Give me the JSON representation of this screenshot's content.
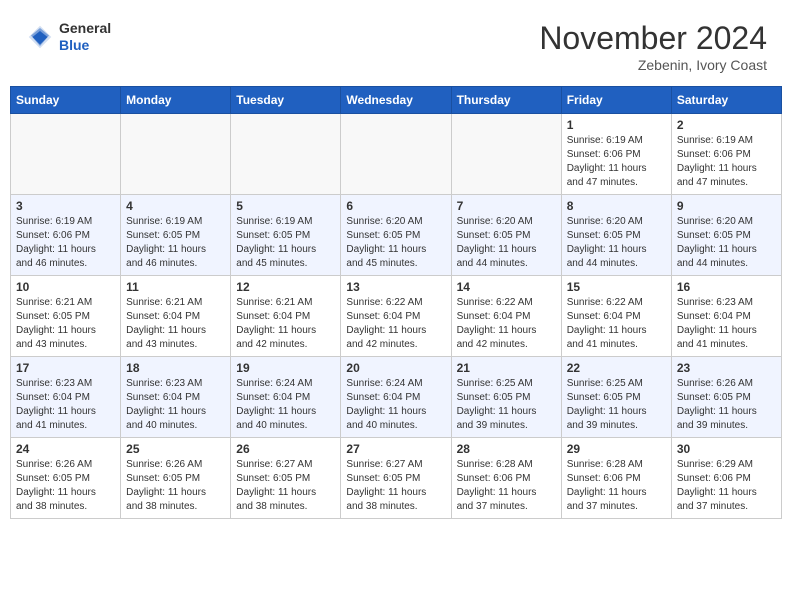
{
  "header": {
    "logo": {
      "general": "General",
      "blue": "Blue"
    },
    "month": "November 2024",
    "location": "Zebenin, Ivory Coast"
  },
  "weekdays": [
    "Sunday",
    "Monday",
    "Tuesday",
    "Wednesday",
    "Thursday",
    "Friday",
    "Saturday"
  ],
  "weeks": [
    [
      {
        "day": "",
        "empty": true
      },
      {
        "day": "",
        "empty": true
      },
      {
        "day": "",
        "empty": true
      },
      {
        "day": "",
        "empty": true
      },
      {
        "day": "",
        "empty": true
      },
      {
        "day": "1",
        "sunrise": "6:19 AM",
        "sunset": "6:06 PM",
        "daylight": "11 hours and 47 minutes."
      },
      {
        "day": "2",
        "sunrise": "6:19 AM",
        "sunset": "6:06 PM",
        "daylight": "11 hours and 47 minutes."
      }
    ],
    [
      {
        "day": "3",
        "sunrise": "6:19 AM",
        "sunset": "6:06 PM",
        "daylight": "11 hours and 46 minutes."
      },
      {
        "day": "4",
        "sunrise": "6:19 AM",
        "sunset": "6:05 PM",
        "daylight": "11 hours and 46 minutes."
      },
      {
        "day": "5",
        "sunrise": "6:19 AM",
        "sunset": "6:05 PM",
        "daylight": "11 hours and 45 minutes."
      },
      {
        "day": "6",
        "sunrise": "6:20 AM",
        "sunset": "6:05 PM",
        "daylight": "11 hours and 45 minutes."
      },
      {
        "day": "7",
        "sunrise": "6:20 AM",
        "sunset": "6:05 PM",
        "daylight": "11 hours and 44 minutes."
      },
      {
        "day": "8",
        "sunrise": "6:20 AM",
        "sunset": "6:05 PM",
        "daylight": "11 hours and 44 minutes."
      },
      {
        "day": "9",
        "sunrise": "6:20 AM",
        "sunset": "6:05 PM",
        "daylight": "11 hours and 44 minutes."
      }
    ],
    [
      {
        "day": "10",
        "sunrise": "6:21 AM",
        "sunset": "6:05 PM",
        "daylight": "11 hours and 43 minutes."
      },
      {
        "day": "11",
        "sunrise": "6:21 AM",
        "sunset": "6:04 PM",
        "daylight": "11 hours and 43 minutes."
      },
      {
        "day": "12",
        "sunrise": "6:21 AM",
        "sunset": "6:04 PM",
        "daylight": "11 hours and 42 minutes."
      },
      {
        "day": "13",
        "sunrise": "6:22 AM",
        "sunset": "6:04 PM",
        "daylight": "11 hours and 42 minutes."
      },
      {
        "day": "14",
        "sunrise": "6:22 AM",
        "sunset": "6:04 PM",
        "daylight": "11 hours and 42 minutes."
      },
      {
        "day": "15",
        "sunrise": "6:22 AM",
        "sunset": "6:04 PM",
        "daylight": "11 hours and 41 minutes."
      },
      {
        "day": "16",
        "sunrise": "6:23 AM",
        "sunset": "6:04 PM",
        "daylight": "11 hours and 41 minutes."
      }
    ],
    [
      {
        "day": "17",
        "sunrise": "6:23 AM",
        "sunset": "6:04 PM",
        "daylight": "11 hours and 41 minutes."
      },
      {
        "day": "18",
        "sunrise": "6:23 AM",
        "sunset": "6:04 PM",
        "daylight": "11 hours and 40 minutes."
      },
      {
        "day": "19",
        "sunrise": "6:24 AM",
        "sunset": "6:04 PM",
        "daylight": "11 hours and 40 minutes."
      },
      {
        "day": "20",
        "sunrise": "6:24 AM",
        "sunset": "6:04 PM",
        "daylight": "11 hours and 40 minutes."
      },
      {
        "day": "21",
        "sunrise": "6:25 AM",
        "sunset": "6:05 PM",
        "daylight": "11 hours and 39 minutes."
      },
      {
        "day": "22",
        "sunrise": "6:25 AM",
        "sunset": "6:05 PM",
        "daylight": "11 hours and 39 minutes."
      },
      {
        "day": "23",
        "sunrise": "6:26 AM",
        "sunset": "6:05 PM",
        "daylight": "11 hours and 39 minutes."
      }
    ],
    [
      {
        "day": "24",
        "sunrise": "6:26 AM",
        "sunset": "6:05 PM",
        "daylight": "11 hours and 38 minutes."
      },
      {
        "day": "25",
        "sunrise": "6:26 AM",
        "sunset": "6:05 PM",
        "daylight": "11 hours and 38 minutes."
      },
      {
        "day": "26",
        "sunrise": "6:27 AM",
        "sunset": "6:05 PM",
        "daylight": "11 hours and 38 minutes."
      },
      {
        "day": "27",
        "sunrise": "6:27 AM",
        "sunset": "6:05 PM",
        "daylight": "11 hours and 38 minutes."
      },
      {
        "day": "28",
        "sunrise": "6:28 AM",
        "sunset": "6:06 PM",
        "daylight": "11 hours and 37 minutes."
      },
      {
        "day": "29",
        "sunrise": "6:28 AM",
        "sunset": "6:06 PM",
        "daylight": "11 hours and 37 minutes."
      },
      {
        "day": "30",
        "sunrise": "6:29 AM",
        "sunset": "6:06 PM",
        "daylight": "11 hours and 37 minutes."
      }
    ]
  ]
}
